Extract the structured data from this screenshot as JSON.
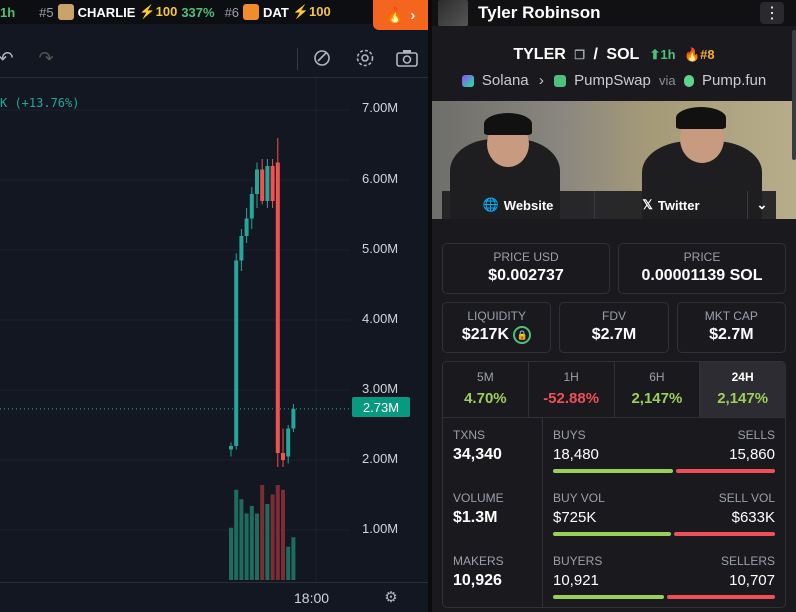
{
  "ticker": [
    {
      "rank": "",
      "symbol": "",
      "boost": "",
      "pct": "",
      "timeframe": "1h"
    },
    {
      "rank": "#5",
      "symbol": "CHARLIE",
      "boost": "⚡100",
      "pct": "337%"
    },
    {
      "rank": "#6",
      "symbol": "DAT",
      "boost": "⚡100",
      "pct": ""
    }
  ],
  "chart": {
    "change_text": "K (+13.76%)",
    "current_price_tag": "2.73M",
    "y_labels": [
      "7.00M",
      "6.00M",
      "5.00M",
      "4.00M",
      "3.00M",
      "2.00M",
      "1.00M"
    ],
    "time_label": "18:00",
    "colors": {
      "up": "#26a69a",
      "down": "#ef5350",
      "bg": "#131722"
    }
  },
  "chart_data": {
    "type": "candlestick",
    "y_unit": "market cap",
    "ylim": [
      0,
      7400000
    ],
    "candles": [
      {
        "o": 2150000,
        "h": 2250000,
        "l": 2050000,
        "c": 2200000,
        "vol": 0.55
      },
      {
        "o": 2200000,
        "h": 4950000,
        "l": 2150000,
        "c": 4850000,
        "vol": 0.95
      },
      {
        "o": 4850000,
        "h": 5300000,
        "l": 4700000,
        "c": 5200000,
        "vol": 0.85
      },
      {
        "o": 5200000,
        "h": 5600000,
        "l": 5100000,
        "c": 5450000,
        "vol": 0.7
      },
      {
        "o": 5450000,
        "h": 5900000,
        "l": 5300000,
        "c": 5800000,
        "vol": 0.78
      },
      {
        "o": 5800000,
        "h": 6250000,
        "l": 5600000,
        "c": 6150000,
        "vol": 0.7
      },
      {
        "o": 6150000,
        "h": 6300000,
        "l": 5650000,
        "c": 5700000,
        "vol": 1.0
      },
      {
        "o": 5700000,
        "h": 6300000,
        "l": 5600000,
        "c": 6200000,
        "vol": 0.8
      },
      {
        "o": 6200000,
        "h": 6300000,
        "l": 5600000,
        "c": 5700000,
        "vol": 0.9
      },
      {
        "o": 6250000,
        "h": 6600000,
        "l": 1900000,
        "c": 2100000,
        "vol": 1.0
      },
      {
        "o": 2100000,
        "h": 2450000,
        "l": 1900000,
        "c": 2000000,
        "vol": 0.95
      },
      {
        "o": 2050000,
        "h": 2500000,
        "l": 1950000,
        "c": 2450000,
        "vol": 0.35
      },
      {
        "o": 2450000,
        "h": 2800000,
        "l": 2400000,
        "c": 2730000,
        "vol": 0.45
      }
    ]
  },
  "toolbar": {
    "undo": "↶",
    "redo": "↷"
  },
  "panel": {
    "header_name": "Tyler Robinson",
    "menu_icon": "⋮",
    "base": "TYLER",
    "quote": "SOL",
    "timeframe": "1h",
    "rank": "#8",
    "chain": "Solana",
    "dex": "PumpSwap",
    "via": "via",
    "launchpad": "Pump.fun",
    "website": "Website",
    "twitter": "Twitter",
    "price_usd_label": "PRICE USD",
    "price_usd": "$0.002737",
    "price_label": "PRICE",
    "price_native": "0.00001139 SOL",
    "liquidity_label": "LIQUIDITY",
    "liquidity": "$217K",
    "fdv_label": "FDV",
    "fdv": "$2.7M",
    "mcap_label": "MKT CAP",
    "mcap": "$2.7M",
    "tabs": [
      {
        "name": "5M",
        "value": "4.70%",
        "sign": "pos"
      },
      {
        "name": "1H",
        "value": "-52.88%",
        "sign": "neg"
      },
      {
        "name": "6H",
        "value": "2,147%",
        "sign": "pos"
      },
      {
        "name": "24H",
        "value": "2,147%",
        "sign": "pos"
      }
    ],
    "txns_label": "TXNS",
    "txns": "34,340",
    "buys_label": "BUYS",
    "buys": "18,480",
    "sells_label": "SELLS",
    "sells": "15,860",
    "volume_label": "VOLUME",
    "volume": "$1.3M",
    "buy_vol_label": "BUY VOL",
    "buy_vol": "$725K",
    "sell_vol_label": "SELL VOL",
    "sell_vol": "$633K",
    "makers_label": "MAKERS",
    "makers": "10,926",
    "buyers_label": "BUYERS",
    "buyers": "10,921",
    "sellers_label": "SELLERS",
    "sellers": "10,707",
    "buy_share": 0.54,
    "buy_vol_share": 0.53,
    "buyer_share": 0.5
  }
}
